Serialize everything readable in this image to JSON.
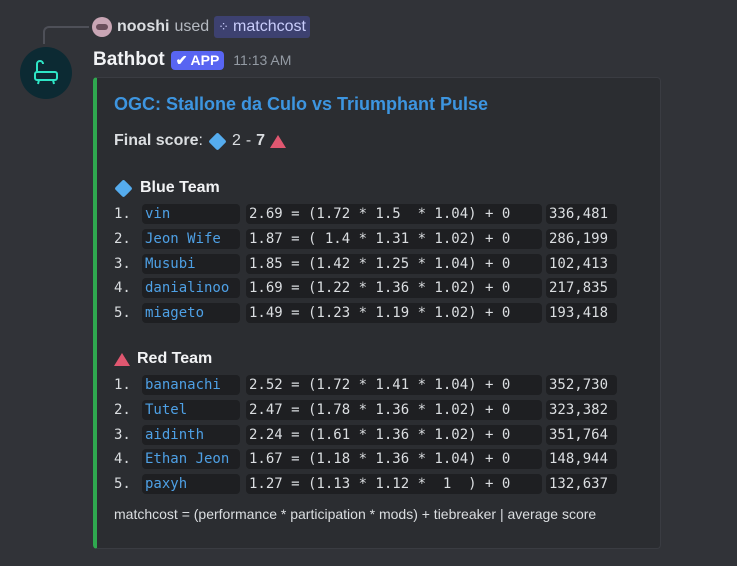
{
  "reply": {
    "user": "nooshi",
    "used": "used",
    "command": "matchcost"
  },
  "author": {
    "name": "Bathbot",
    "tag": "APP",
    "time": "11:13 AM"
  },
  "embed": {
    "title": "OGC: Stallone da Culo vs Triumphant Pulse",
    "final_label": "Final score",
    "blue_score": "2",
    "dash": "-",
    "red_score": "7",
    "blue_team": "Blue Team",
    "red_team": "Red Team",
    "blue_rows": [
      {
        "rank": "1.",
        "name": "vin",
        "calc": "2.69 = (1.72 * 1.5  * 1.04) + 0",
        "score": "336,481"
      },
      {
        "rank": "2.",
        "name": "Jeon Wife",
        "calc": "1.87 = ( 1.4 * 1.31 * 1.02) + 0",
        "score": "286,199"
      },
      {
        "rank": "3.",
        "name": "Musubi",
        "calc": "1.85 = (1.42 * 1.25 * 1.04) + 0",
        "score": "102,413"
      },
      {
        "rank": "4.",
        "name": "danialinoo",
        "calc": "1.69 = (1.22 * 1.36 * 1.02) + 0",
        "score": "217,835"
      },
      {
        "rank": "5.",
        "name": "miageto",
        "calc": "1.49 = (1.23 * 1.19 * 1.02) + 0",
        "score": "193,418"
      }
    ],
    "red_rows": [
      {
        "rank": "1.",
        "name": "bananachi",
        "calc": "2.52 = (1.72 * 1.41 * 1.04) + 0",
        "score": "352,730"
      },
      {
        "rank": "2.",
        "name": "Tutel",
        "calc": "2.47 = (1.78 * 1.36 * 1.02) + 0",
        "score": "323,382"
      },
      {
        "rank": "3.",
        "name": "aidinth",
        "calc": "2.24 = (1.61 * 1.36 * 1.02) + 0",
        "score": "351,764"
      },
      {
        "rank": "4.",
        "name": "Ethan Jeon",
        "calc": "1.67 = (1.18 * 1.36 * 1.04) + 0",
        "score": "148,944"
      },
      {
        "rank": "5.",
        "name": "paxyh",
        "calc": "1.27 = (1.13 * 1.12 *  1  ) + 0",
        "score": "132,637"
      }
    ],
    "footer": "matchcost = (performance * participation * mods) + tiebreaker | average score"
  },
  "colors": {
    "accent": "#2fa84f",
    "link": "#3d95e0",
    "blue": "#55acee",
    "red": "#e05770",
    "app": "#5865f2"
  },
  "icons": {
    "blue": "large-blue-diamond-icon",
    "red": "red-triangle-icon",
    "command": "slash-command-icon",
    "avatar": "bathtub-icon"
  }
}
